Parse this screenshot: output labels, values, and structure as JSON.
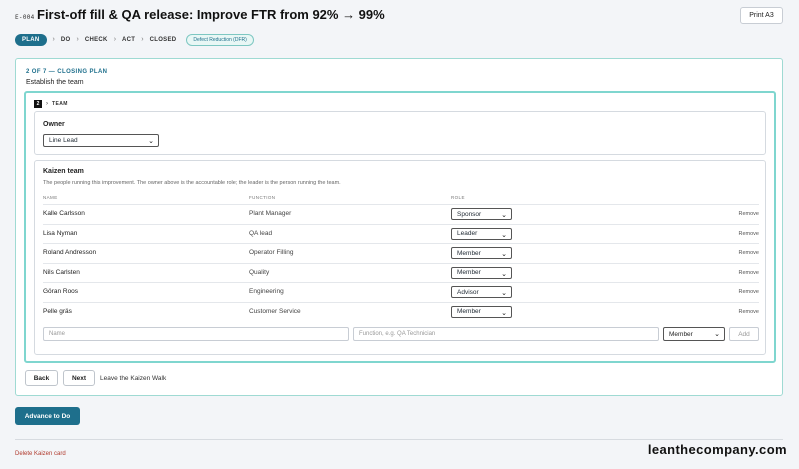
{
  "header": {
    "code": "E-004",
    "title": "First-off fill & QA release: Improve FTR from 92% → 99%",
    "print_label": "Print A3"
  },
  "steps": {
    "items": [
      "PLAN",
      "DO",
      "CHECK",
      "ACT",
      "CLOSED"
    ],
    "active_index": 0,
    "tag": "Defect Reduction (DFR)"
  },
  "plan": {
    "eyebrow": "2 OF 7 — CLOSING PLAN",
    "subtitle": "Establish the team",
    "section_number": "2",
    "section_label": "TEAM",
    "owner": {
      "label": "Owner",
      "value": "Line Lead"
    },
    "kaizen": {
      "title": "Kaizen team",
      "description": "The people running this improvement. The owner above is the accountable role; the leader is the person running the team.",
      "columns": [
        "NAME",
        "FUNCTION",
        "ROLE"
      ],
      "remove_label": "Remove",
      "members": [
        {
          "name": "Kalle Carlsson",
          "function": "Plant Manager",
          "role": "Sponsor"
        },
        {
          "name": "Lisa Nyman",
          "function": "QA lead",
          "role": "Leader"
        },
        {
          "name": "Roland Andresson",
          "function": "Operator Filling",
          "role": "Member"
        },
        {
          "name": "Nils Carlsten",
          "function": "Quality",
          "role": "Member"
        },
        {
          "name": "Göran Roos",
          "function": "Engineering",
          "role": "Advisor"
        },
        {
          "name": "Pelle gräs",
          "function": "Customer Service",
          "role": "Member"
        }
      ],
      "new_member": {
        "name_placeholder": "Name",
        "function_placeholder": "Function, e.g. QA Technician",
        "role_value": "Member",
        "add_label": "Add"
      }
    },
    "nav": {
      "back_label": "Back",
      "next_label": "Next",
      "leave_label": "Leave the Kaizen Walk"
    }
  },
  "footer": {
    "advance_label": "Advance to Do",
    "delete_label": "Delete Kaizen card",
    "watermark": "leanthecompany.com"
  },
  "colors": {
    "accent": "#1e6f8c",
    "panel_border": "#7fd6cf",
    "danger": "#b03a2e"
  }
}
